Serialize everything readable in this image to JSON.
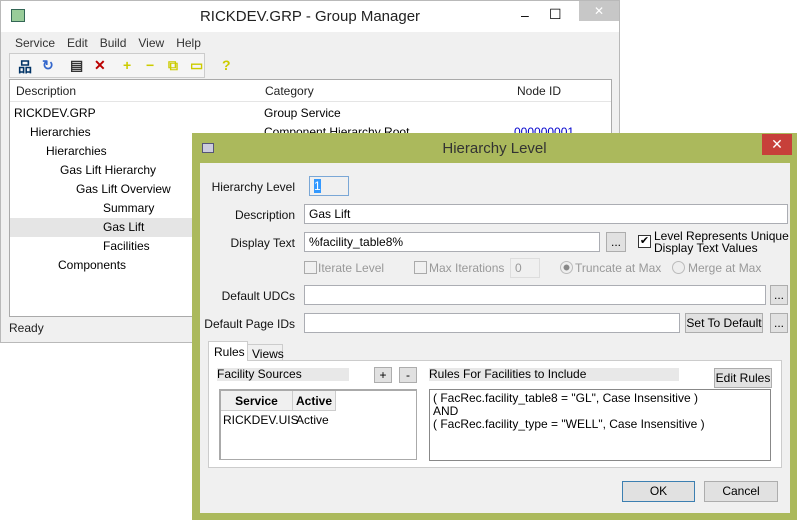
{
  "main": {
    "title": "RICKDEV.GRP - Group Manager",
    "menu": [
      "Service",
      "Edit",
      "Build",
      "View",
      "Help"
    ],
    "columns": [
      "Description",
      "Category",
      "Node ID"
    ],
    "rows": [
      {
        "label": "RICKDEV.GRP",
        "category": "Group Service",
        "node_id": ""
      },
      {
        "label": "Hierarchies",
        "category": "Component Hierarchy Root",
        "node_id": "000000001"
      },
      {
        "label": "Hierarchies",
        "category": "",
        "node_id": ""
      },
      {
        "label": "Gas Lift Hierarchy",
        "category": "",
        "node_id": ""
      },
      {
        "label": "Gas Lift Overview",
        "category": "",
        "node_id": ""
      },
      {
        "label": "Summary",
        "category": "",
        "node_id": ""
      },
      {
        "label": "Gas Lift",
        "category": "",
        "node_id": ""
      },
      {
        "label": "Facilities",
        "category": "",
        "node_id": ""
      },
      {
        "label": "Components",
        "category": "",
        "node_id": ""
      }
    ],
    "status": "Ready",
    "min": "–",
    "max": "☐",
    "close": "✕"
  },
  "dialog": {
    "title": "Hierarchy Level",
    "close": "✕",
    "hierarchy_level_label": "Hierarchy Level",
    "hierarchy_level": "1",
    "description_label": "Description",
    "description": "Gas Lift",
    "display_text_label": "Display Text",
    "display_text": "%facility_table8%",
    "ellipsis": "...",
    "unique_label_1": "Level Represents Unique",
    "unique_label_2": "Display Text Values",
    "iterate_label": "Iterate Level",
    "max_iter_label": "Max Iterations",
    "max_iter": "0",
    "truncate_label": "Truncate at Max",
    "merge_label": "Merge at Max",
    "udcs_label": "Default UDCs",
    "udcs": "",
    "page_ids_label": "Default Page IDs",
    "page_ids": "",
    "set_default": "Set To Default",
    "tabs": [
      "Rules",
      "Views"
    ],
    "facility_sources": "Facility Sources",
    "plus": "+",
    "minus": "-",
    "src_cols": [
      "Service",
      "Active"
    ],
    "src_rows": [
      {
        "service": "RICKDEV.UIS",
        "active": "Active"
      }
    ],
    "rules_label": "Rules For Facilities to Include",
    "edit_rules": "Edit Rules",
    "rules": [
      "( FacRec.facility_table8 = \"GL\", Case Insensitive )",
      "AND",
      "( FacRec.facility_type = \"WELL\", Case Insensitive )"
    ],
    "ok": "OK",
    "cancel": "Cancel"
  }
}
